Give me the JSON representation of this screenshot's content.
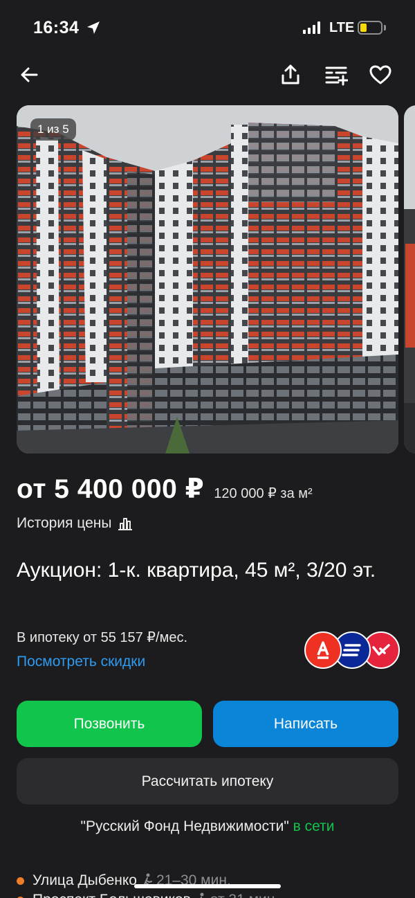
{
  "status_bar": {
    "time": "16:34",
    "network": "LTE"
  },
  "gallery": {
    "counter": "1 из 5"
  },
  "listing": {
    "price": "от 5 400 000 ₽",
    "price_per_sqm": "120 000 ₽ за м²",
    "price_history_label": "История цены",
    "title": "Аукцион: 1-к. квартира, 45 м², 3/20 эт.",
    "mortgage_text": "В ипотеку от 55 157 ₽/мес.",
    "discounts_link": "Посмотреть скидки"
  },
  "actions": {
    "call_label": "Позвонить",
    "write_label": "Написать",
    "calc_label": "Рассчитать ипотеку"
  },
  "seller": {
    "name": "\"Русский Фонд Недвижимости\"",
    "status": "в сети"
  },
  "metro": [
    {
      "station": "Улица Дыбенко",
      "time": "21–30 мин.",
      "color": "#f07d28"
    },
    {
      "station": "Проспект Большевиков",
      "time": "от 31 мин.",
      "color": "#f07d28"
    }
  ],
  "colors": {
    "background": "#1c1c1e",
    "call_button": "#10c44c",
    "write_button": "#0a85d8",
    "link": "#2f9bf0",
    "online": "#10c44c"
  },
  "icons": [
    "back-arrow-icon",
    "share-icon",
    "compare-list-icon",
    "heart-icon",
    "price-chart-icon",
    "walk-icon"
  ]
}
